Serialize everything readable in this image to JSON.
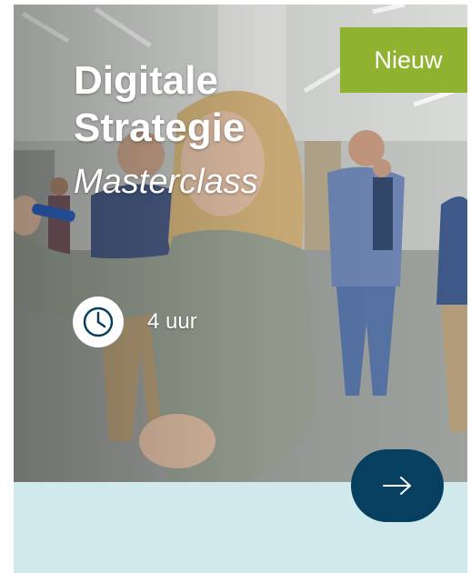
{
  "course": {
    "title_line1": "Digitale",
    "title_line2": "Strategie",
    "subtitle": "Masterclass",
    "badge": "Nieuw",
    "duration": "4 uur"
  },
  "icons": {
    "duration": "clock-icon",
    "action": "arrow-right-icon"
  },
  "colors": {
    "badge_bg": "#8fb231",
    "button_bg": "#063f5f",
    "card_bg": "#cfe9ec",
    "text": "#ffffff"
  }
}
